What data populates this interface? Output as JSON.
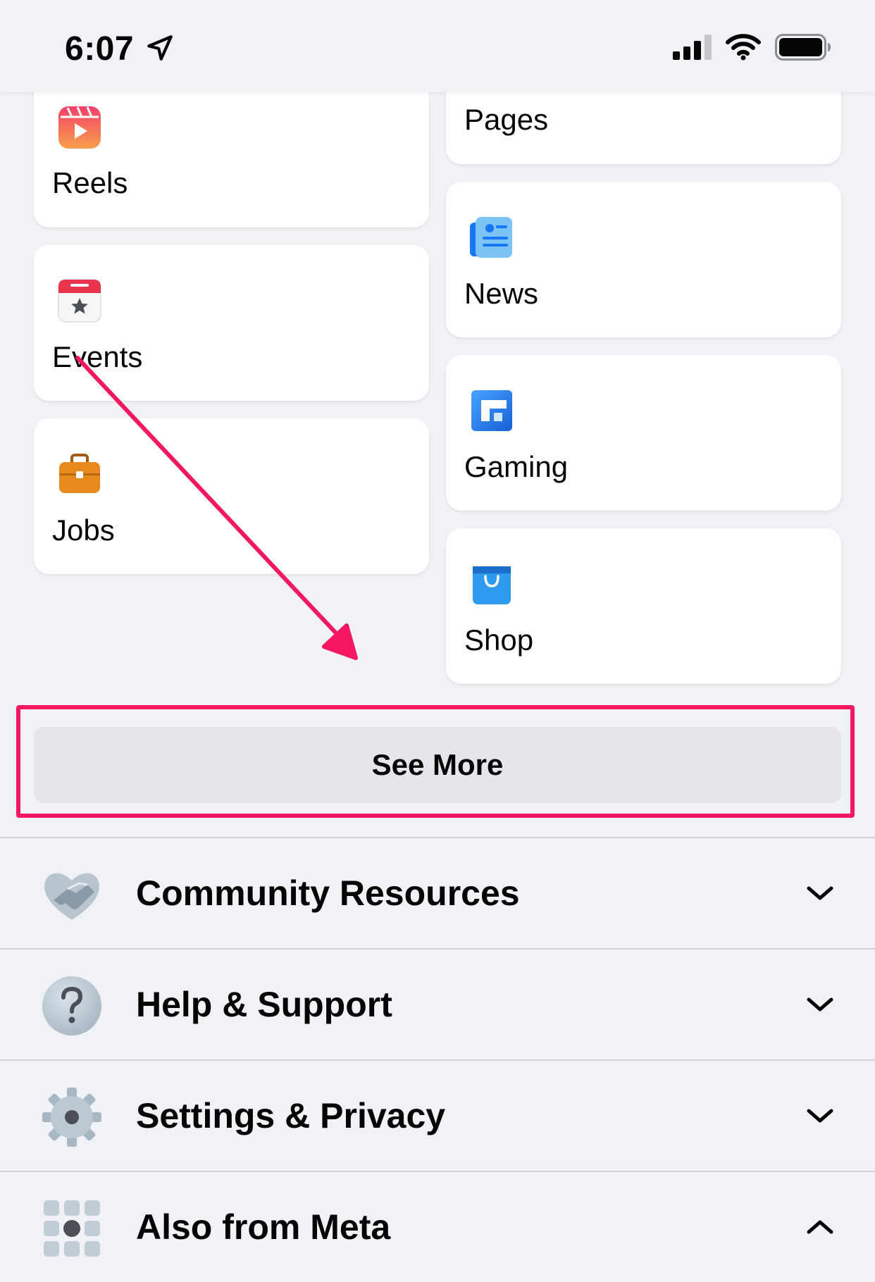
{
  "status_bar": {
    "time": "6:07"
  },
  "shortcuts": {
    "left": [
      {
        "label": "Reels",
        "icon": "reels-icon"
      },
      {
        "label": "Events",
        "icon": "events-calendar-icon"
      },
      {
        "label": "Jobs",
        "icon": "jobs-briefcase-icon"
      }
    ],
    "right": [
      {
        "label": "Pages",
        "icon": "pages-flag-icon"
      },
      {
        "label": "News",
        "icon": "news-icon"
      },
      {
        "label": "Gaming",
        "icon": "gaming-icon"
      },
      {
        "label": "Shop",
        "icon": "shop-bag-icon"
      }
    ]
  },
  "see_more": {
    "label": "See More",
    "highlight_color": "#f5175f"
  },
  "sections": [
    {
      "label": "Community Resources",
      "icon": "handshake-icon",
      "state": "collapsed"
    },
    {
      "label": "Help & Support",
      "icon": "question-mark-icon",
      "state": "collapsed"
    },
    {
      "label": "Settings & Privacy",
      "icon": "gear-icon",
      "state": "collapsed"
    },
    {
      "label": "Also from Meta",
      "icon": "apps-grid-icon",
      "state": "expanded"
    }
  ],
  "colors": {
    "background": "#f0f2f5",
    "card": "#ffffff",
    "button": "#e4e6eb",
    "annotation": "#f5175f"
  }
}
